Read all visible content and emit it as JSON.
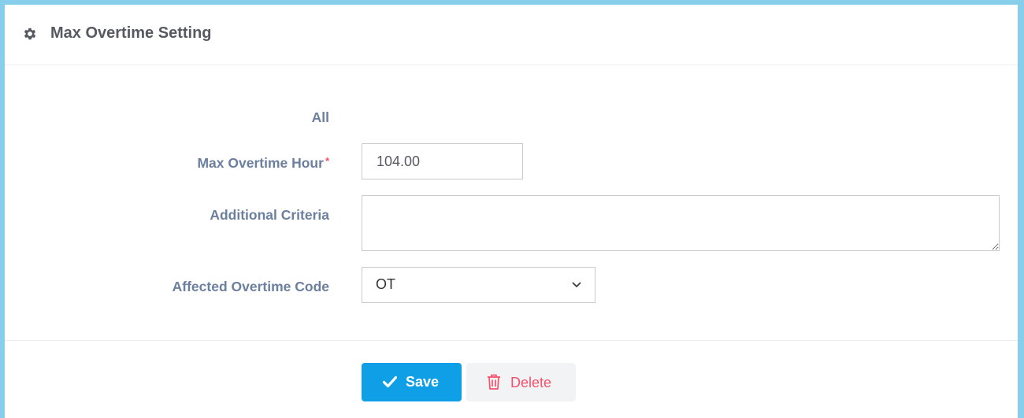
{
  "header": {
    "title": "Max Overtime Setting",
    "icon": "gear-icon"
  },
  "form": {
    "all_label": "All",
    "max_hour_label": "Max Overtime Hour",
    "required_mark": "*",
    "max_hour_value": "104.00",
    "additional_criteria_label": "Additional Criteria",
    "additional_criteria_value": "",
    "affected_code_label": "Affected Overtime Code",
    "affected_code_value": "OT"
  },
  "footer": {
    "save_label": "Save",
    "save_icon": "check-icon",
    "delete_label": "Delete",
    "delete_icon": "trash-icon"
  },
  "colors": {
    "accent": "#0f9fe6",
    "danger": "#f4516c",
    "label": "#6b7f9e",
    "frame": "#87ceeb"
  }
}
